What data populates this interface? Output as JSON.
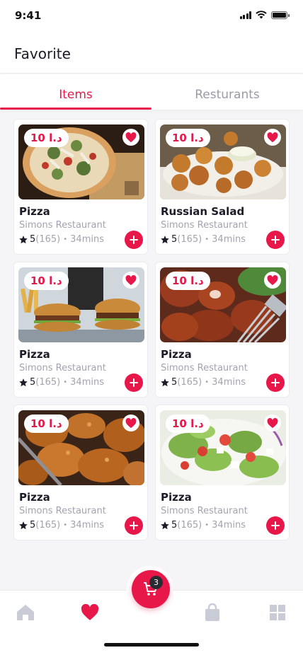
{
  "status": {
    "time": "9:41"
  },
  "header": {
    "title": "Favorite"
  },
  "tabs": [
    {
      "label": "Items",
      "active": true
    },
    {
      "label": "Resturants",
      "active": false
    }
  ],
  "items": [
    {
      "price": "10 د.ا",
      "title": "Pizza",
      "restaurant": "Simons Restaurant",
      "rating": "5",
      "reviews": "(165)",
      "time": "34mins",
      "image": "pizza"
    },
    {
      "price": "10 د.ا",
      "title": "Russian Salad",
      "restaurant": "Simons Restaurant",
      "rating": "5",
      "reviews": "(165)",
      "time": "34mins",
      "image": "fried-bites"
    },
    {
      "price": "10 د.ا",
      "title": "Pizza",
      "restaurant": "Simons Restaurant",
      "rating": "5",
      "reviews": "(165)",
      "time": "34mins",
      "image": "burgers"
    },
    {
      "price": "10 د.ا",
      "title": "Pizza",
      "restaurant": "Simons Restaurant",
      "rating": "5",
      "reviews": "(165)",
      "time": "34mins",
      "image": "wings"
    },
    {
      "price": "10 د.ا",
      "title": "Pizza",
      "restaurant": "Simons Restaurant",
      "rating": "5",
      "reviews": "(165)",
      "time": "34mins",
      "image": "fried-chicken"
    },
    {
      "price": "10 د.ا",
      "title": "Pizza",
      "restaurant": "Simons Restaurant",
      "rating": "5",
      "reviews": "(165)",
      "time": "34mins",
      "image": "salad"
    }
  ],
  "cart": {
    "count": "3"
  },
  "nav": [
    "home-icon",
    "heart-icon",
    "cart-icon",
    "bag-icon",
    "grid-icon"
  ],
  "colors": {
    "accent": "#e8174a",
    "inactive": "#c9ccd6"
  }
}
